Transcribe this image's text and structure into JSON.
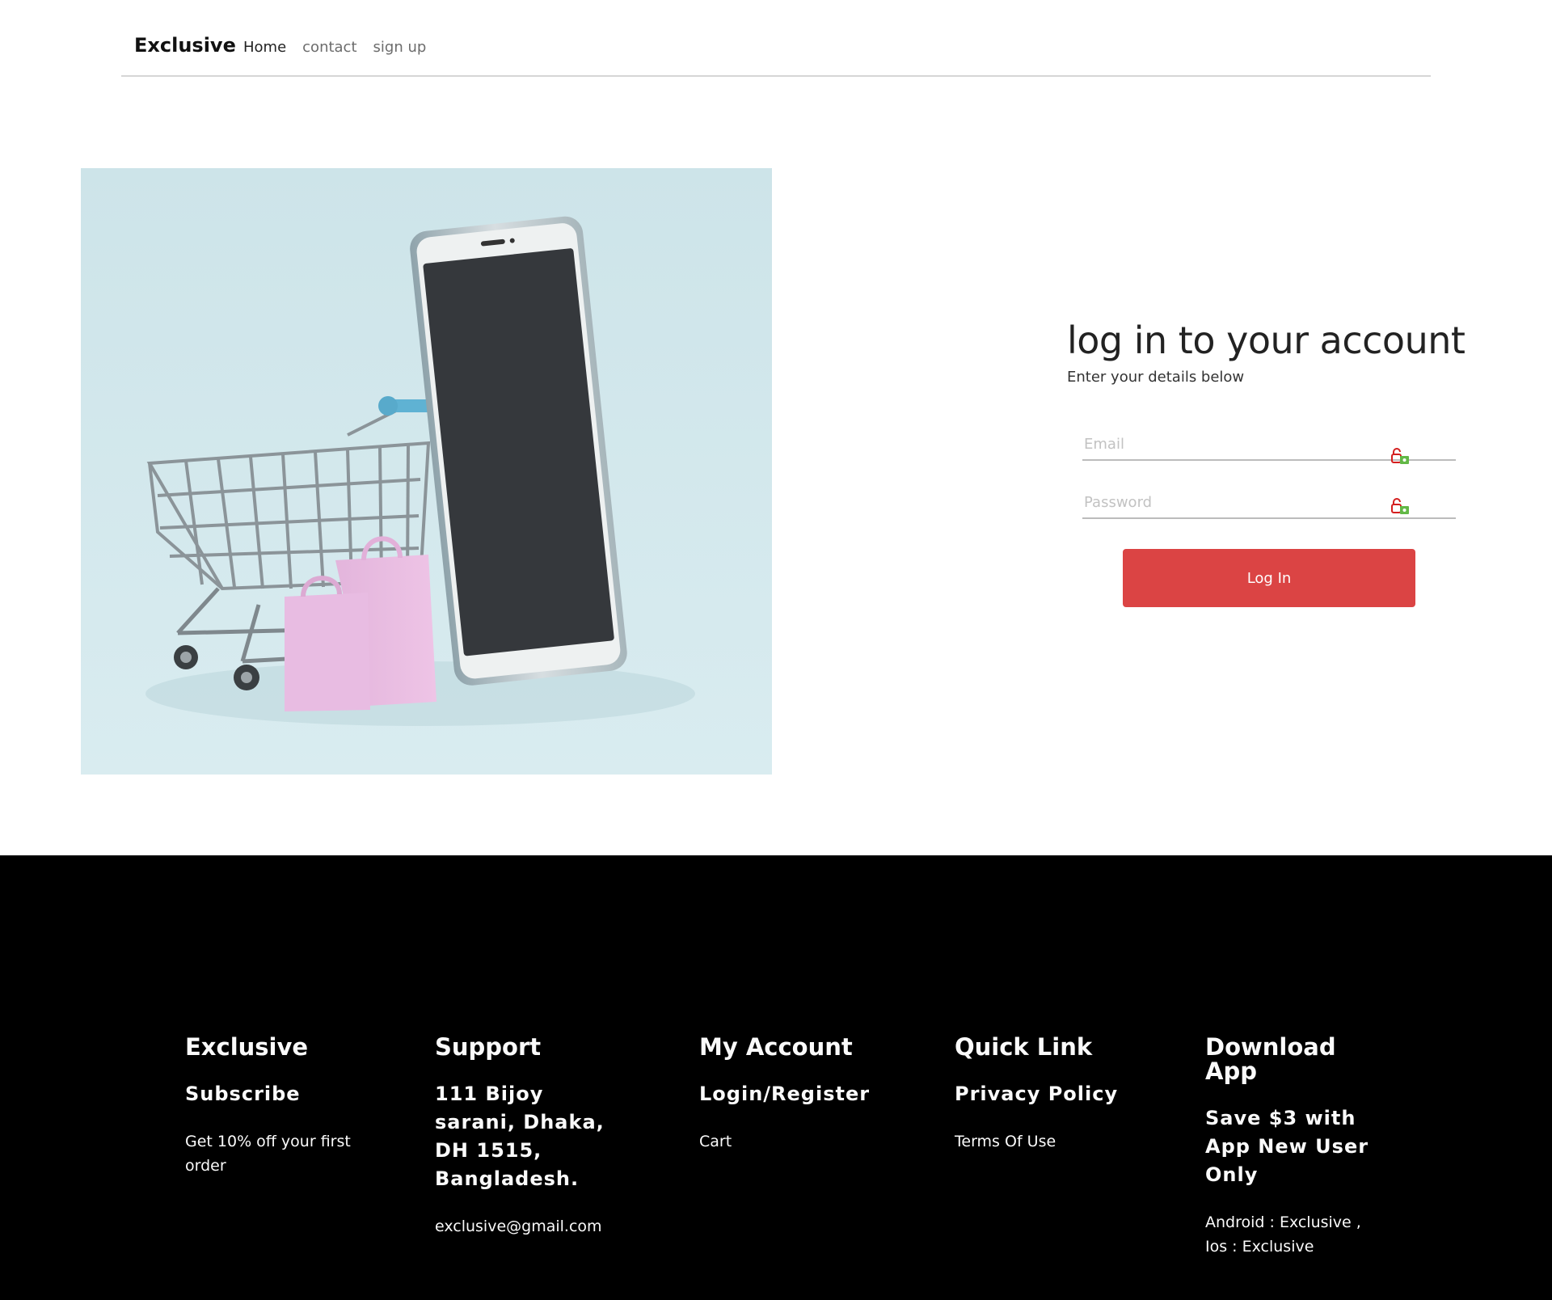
{
  "navbar": {
    "brand": "Exclusive",
    "links": [
      "Home",
      "contact",
      "sign up"
    ]
  },
  "login": {
    "title": "log in to your account",
    "subtitle": "Enter your details below",
    "email_placeholder": "Email",
    "password_placeholder": "Password",
    "submit_label": "Log In",
    "accent_color": "#db4444"
  },
  "footer": {
    "col1": {
      "heading": "Exclusive",
      "subheading": "Subscribe",
      "text": "Get 10% off your first order"
    },
    "col2": {
      "heading": "Support",
      "address": "111 Bijoy sarani, Dhaka, DH 1515, Bangladesh.",
      "email": "exclusive@gmail.com"
    },
    "col3": {
      "heading": "My Account",
      "item1": "Login/Register",
      "item2": "Cart"
    },
    "col4": {
      "heading": "Quick Link",
      "item1": "Privacy Policy",
      "item2": "Terms Of Use"
    },
    "col5": {
      "heading": "Download App",
      "promo": "Save $3 with App New User Only",
      "platforms": "Android : Exclusive , Ios : Exclusive"
    }
  }
}
